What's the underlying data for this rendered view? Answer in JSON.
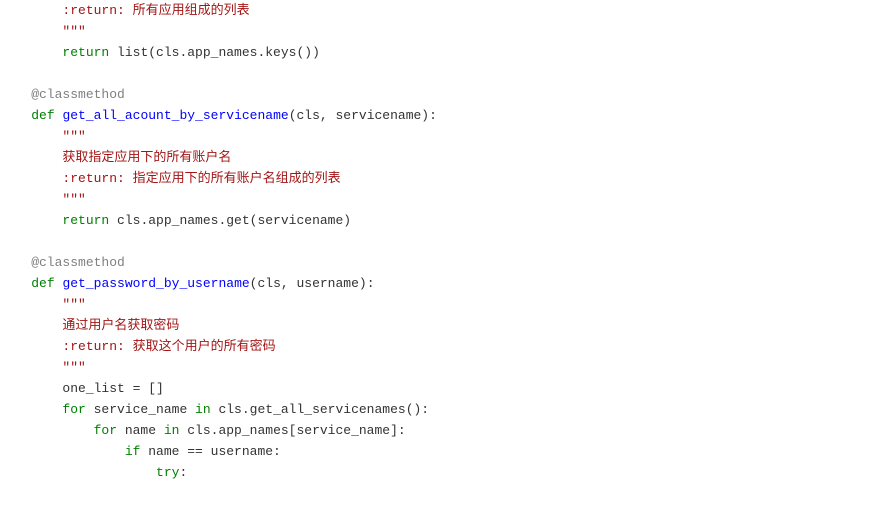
{
  "code": {
    "l1": "        :return: 所有应用组成的列表",
    "l2": "        \"\"\"",
    "l3a": "        ",
    "l3b": "return",
    "l3c": " list(cls.app_names.keys())",
    "l4": "",
    "l5": "    @classmethod",
    "l6a": "    ",
    "l6b": "def",
    "l6c": " ",
    "l6d": "get_all_acount_by_servicename",
    "l6e": "(cls, servicename):",
    "l7": "        \"\"\"",
    "l8": "        获取指定应用下的所有账户名",
    "l9": "        :return: 指定应用下的所有账户名组成的列表",
    "l10": "        \"\"\"",
    "l11a": "        ",
    "l11b": "return",
    "l11c": " cls.app_names.get(servicename)",
    "l12": "",
    "l13": "    @classmethod",
    "l14a": "    ",
    "l14b": "def",
    "l14c": " ",
    "l14d": "get_password_by_username",
    "l14e": "(cls, username):",
    "l15": "        \"\"\"",
    "l16": "        通过用户名获取密码",
    "l17": "        :return: 获取这个用户的所有密码",
    "l18": "        \"\"\"",
    "l19": "        one_list = []",
    "l20a": "        ",
    "l20b": "for",
    "l20c": " service_name ",
    "l20d": "in",
    "l20e": " cls.get_all_servicenames():",
    "l21a": "            ",
    "l21b": "for",
    "l21c": " name ",
    "l21d": "in",
    "l21e": " cls.app_names[service_name]:",
    "l22a": "                ",
    "l22b": "if",
    "l22c": " name == username:",
    "l23a": "                    ",
    "l23b": "try",
    "l23c": ":"
  }
}
